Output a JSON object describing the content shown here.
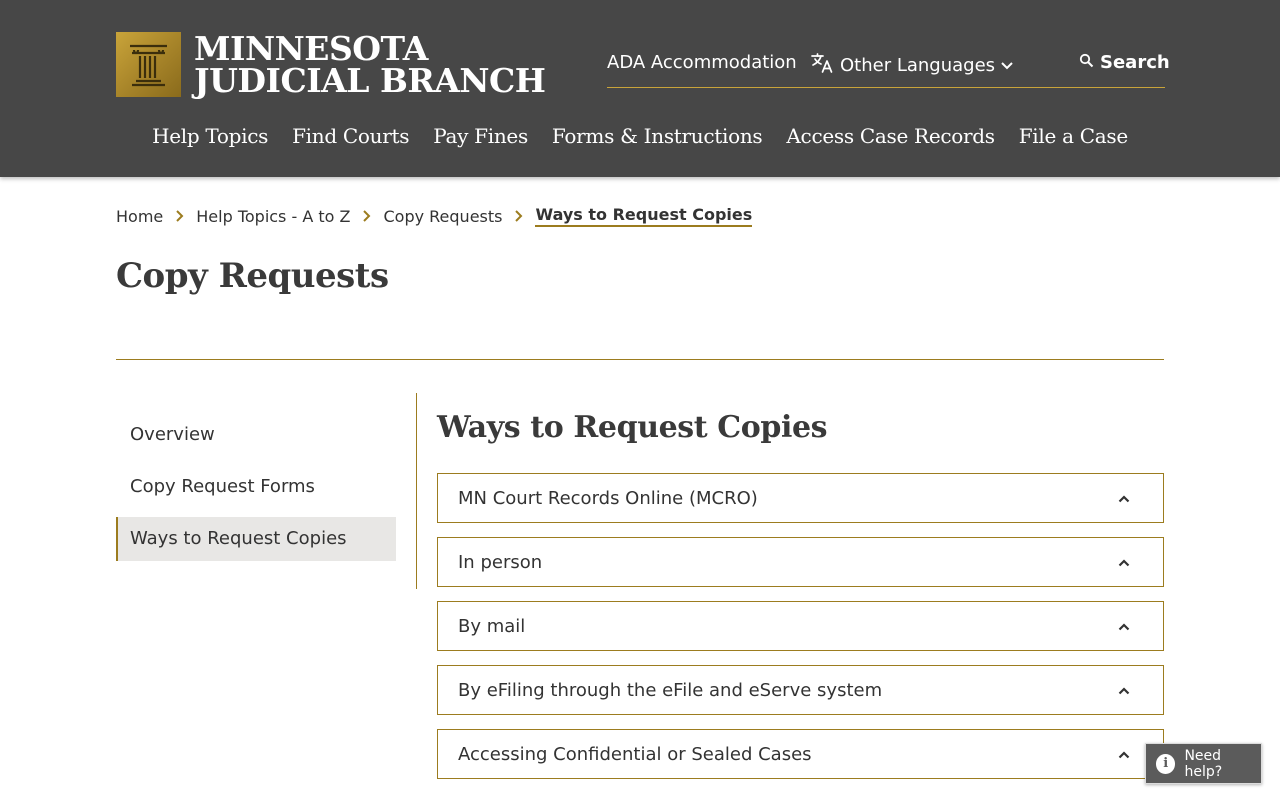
{
  "header": {
    "logo": {
      "line1": "MINNESOTA",
      "line2": "JUDICIAL BRANCH"
    },
    "utility": {
      "ada": "ADA Accommodation",
      "languages": "Other Languages",
      "search": "Search"
    },
    "nav": [
      {
        "label": "Help Topics"
      },
      {
        "label": "Find Courts"
      },
      {
        "label": "Pay Fines"
      },
      {
        "label": "Forms & Instructions"
      },
      {
        "label": "Access Case Records"
      },
      {
        "label": "File a Case"
      }
    ]
  },
  "breadcrumb": {
    "items": [
      {
        "label": "Home"
      },
      {
        "label": "Help Topics - A to Z"
      },
      {
        "label": "Copy Requests"
      }
    ],
    "current": "Ways to Request Copies"
  },
  "page_title": "Copy Requests",
  "sidenav": {
    "items": [
      {
        "label": "Overview",
        "active": false
      },
      {
        "label": "Copy Request Forms",
        "active": false
      },
      {
        "label": "Ways to Request Copies",
        "active": true
      }
    ]
  },
  "content": {
    "title": "Ways to Request Copies",
    "accordion": [
      {
        "label": "MN Court Records Online (MCRO)"
      },
      {
        "label": "In person"
      },
      {
        "label": "By mail"
      },
      {
        "label": "By eFiling through the eFile and eServe system"
      },
      {
        "label": "Accessing Confidential or Sealed Cases"
      }
    ]
  },
  "help_widget": {
    "label": "Need help?",
    "icon_glyph": "i"
  },
  "colors": {
    "header_bg": "#474747",
    "accent_gold": "#9c7c1f",
    "logo_gold": "#c9a43a",
    "active_bg": "#e8e7e5"
  },
  "icons": {
    "breadcrumb_separator": "chevron-right-icon",
    "accordion_toggle": "chevron-up-icon",
    "language": "translate-icon",
    "search": "search-icon"
  }
}
